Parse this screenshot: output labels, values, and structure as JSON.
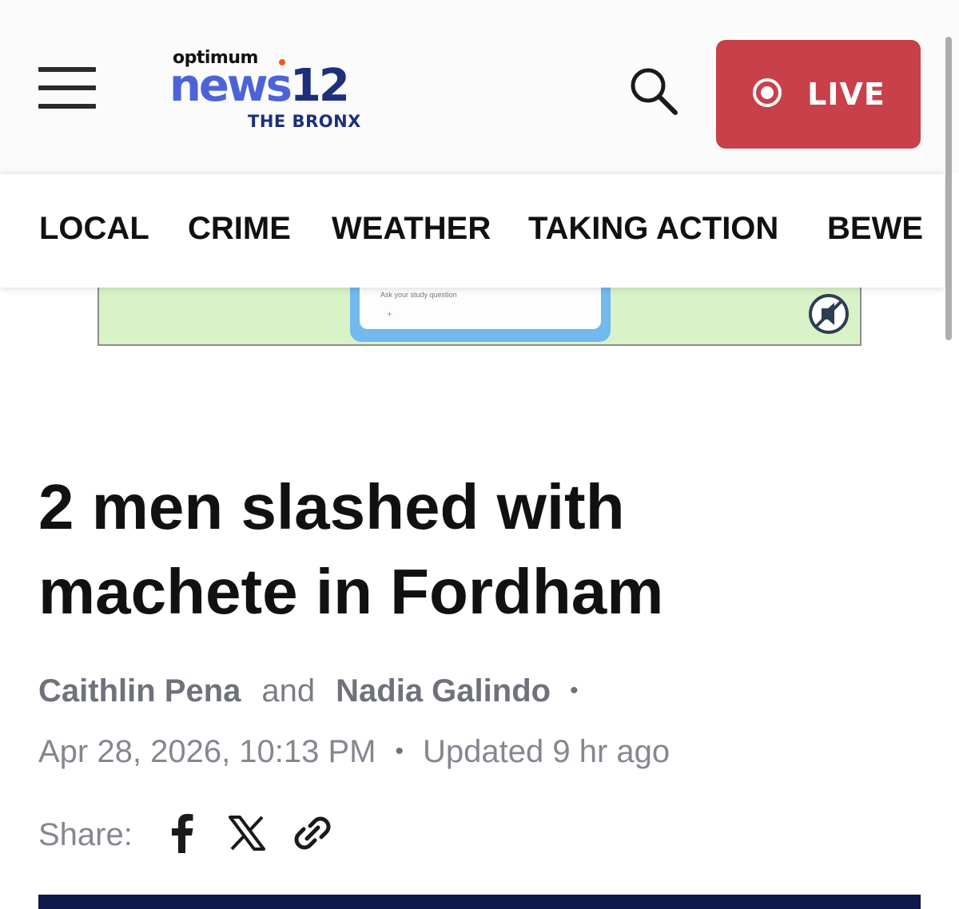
{
  "header": {
    "logo": {
      "optimum": "optimum",
      "news": "news",
      "number": "12",
      "region": "THE BRONX"
    },
    "live_label": "LIVE",
    "colors": {
      "live_bg": "#c8404a",
      "logo_blue": "#4c63d8",
      "logo_navy": "#1d2f7a",
      "logo_orange": "#f05a22"
    }
  },
  "nav": {
    "items": [
      "LOCAL",
      "CRIME",
      "WEATHER",
      "TAKING ACTION",
      "BEWE"
    ]
  },
  "ad": {
    "input_placeholder": "Ask your study question",
    "plus": "+"
  },
  "article": {
    "headline_line1": "2 men slashed with",
    "headline_line2": "machete in Fordham",
    "authors": [
      "Caithlin Pena",
      "Nadia Galindo"
    ],
    "author_joiner": "and",
    "separator": "•",
    "published": "Apr 28, 2026, 10:13 PM",
    "updated": "Updated 9 hr ago",
    "share_label": "Share:"
  },
  "icons": {
    "menu": "hamburger-menu-icon",
    "search": "search-icon",
    "live": "live-record-icon",
    "ad_close": "ad-close-icon",
    "facebook": "facebook-icon",
    "x": "x-icon",
    "link": "link-icon"
  }
}
